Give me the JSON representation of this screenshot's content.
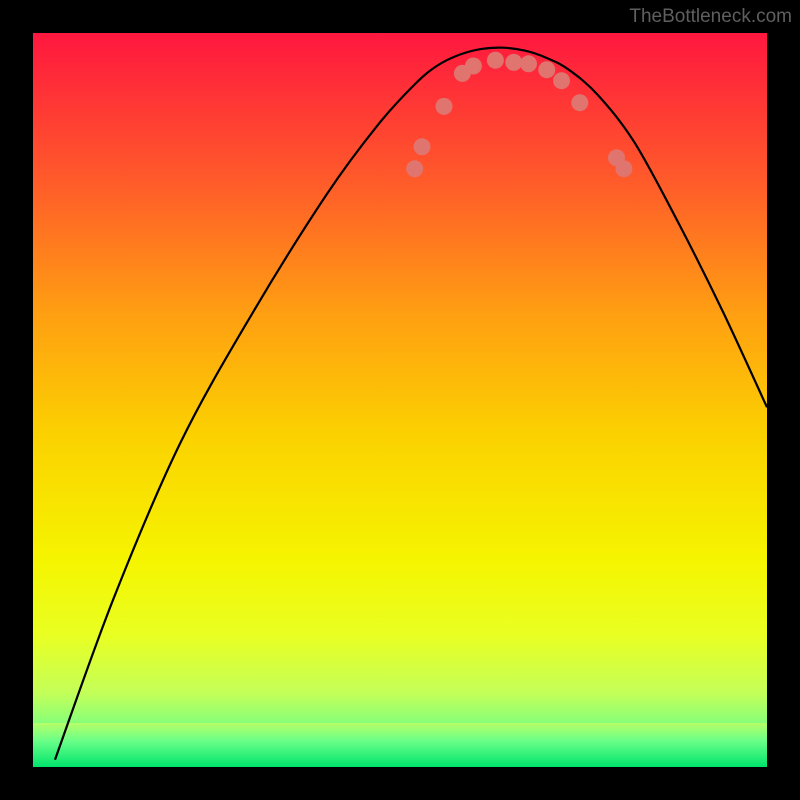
{
  "header": {
    "attribution": "TheBottleneck.com"
  },
  "chart_data": {
    "type": "line",
    "title": "",
    "xlabel": "",
    "ylabel": "",
    "x_range": [
      0,
      100
    ],
    "y_range": [
      0,
      100
    ],
    "axes_visible": false,
    "grid": false,
    "background": {
      "kind": "vertical-gradient",
      "stops": [
        {
          "pos": 0.0,
          "color": "#ff173f"
        },
        {
          "pos": 0.5,
          "color": "#fbc800"
        },
        {
          "pos": 0.78,
          "color": "#f3fa00"
        },
        {
          "pos": 0.88,
          "color": "#d7ff4b"
        },
        {
          "pos": 0.96,
          "color": "#6bff88"
        },
        {
          "pos": 1.0,
          "color": "#00e46c"
        }
      ]
    },
    "green_band": {
      "y0": 94,
      "y1": 100,
      "color_top": "#8dff78",
      "color_bottom": "#00e46c"
    },
    "series": [
      {
        "name": "bottleneck-curve",
        "points": [
          {
            "x": 3.0,
            "y": 1.0
          },
          {
            "x": 11.0,
            "y": 23.0
          },
          {
            "x": 20.0,
            "y": 44.0
          },
          {
            "x": 30.0,
            "y": 62.0
          },
          {
            "x": 40.0,
            "y": 78.0
          },
          {
            "x": 47.0,
            "y": 87.5
          },
          {
            "x": 52.0,
            "y": 93.0
          },
          {
            "x": 55.0,
            "y": 95.5
          },
          {
            "x": 58.0,
            "y": 97.0
          },
          {
            "x": 61.0,
            "y": 97.8
          },
          {
            "x": 64.0,
            "y": 98.0
          },
          {
            "x": 67.0,
            "y": 97.6
          },
          {
            "x": 70.0,
            "y": 96.6
          },
          {
            "x": 73.0,
            "y": 95.0
          },
          {
            "x": 77.0,
            "y": 91.5
          },
          {
            "x": 82.0,
            "y": 85.0
          },
          {
            "x": 88.0,
            "y": 74.0
          },
          {
            "x": 94.0,
            "y": 62.0
          },
          {
            "x": 100.0,
            "y": 49.0
          }
        ]
      }
    ],
    "markers": {
      "kind": "scatter",
      "color": "#e0746f",
      "radius": 8.5,
      "points": [
        {
          "x": 52.0,
          "y": 81.5
        },
        {
          "x": 53.0,
          "y": 84.5
        },
        {
          "x": 56.0,
          "y": 90.0
        },
        {
          "x": 58.5,
          "y": 94.5
        },
        {
          "x": 60.0,
          "y": 95.5
        },
        {
          "x": 63.0,
          "y": 96.3
        },
        {
          "x": 65.5,
          "y": 96.0
        },
        {
          "x": 67.5,
          "y": 95.8
        },
        {
          "x": 70.0,
          "y": 95.0
        },
        {
          "x": 72.0,
          "y": 93.5
        },
        {
          "x": 74.5,
          "y": 90.5
        },
        {
          "x": 79.5,
          "y": 83.0
        },
        {
          "x": 80.5,
          "y": 81.5
        }
      ]
    }
  }
}
